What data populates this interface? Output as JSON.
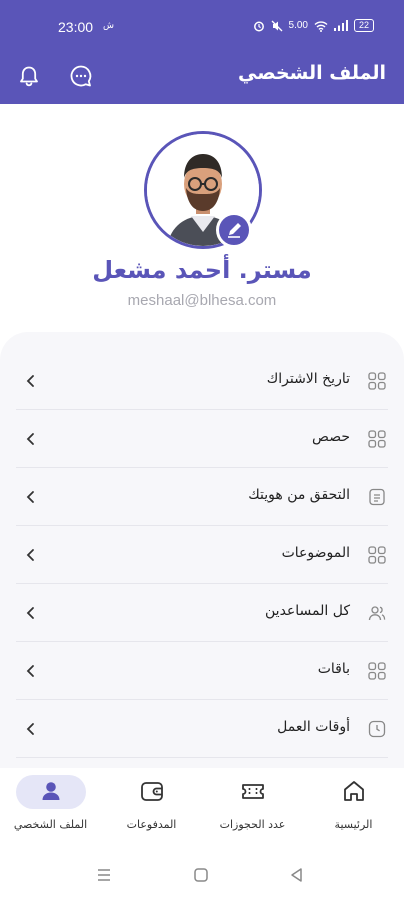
{
  "status_bar": {
    "time": "23:00",
    "left_icon": "ش",
    "speed": "5.00",
    "battery": "22"
  },
  "header": {
    "title": "الملف الشخصي",
    "icons": [
      "bell-icon",
      "chat-icon"
    ]
  },
  "profile": {
    "name": "مستر. أحمد مشعل",
    "email": "meshaal@blhesa.com",
    "edit_icon": "pen-icon"
  },
  "menu": {
    "items": [
      {
        "label": "تاريخ الاشتراك",
        "icon": "grid-icon"
      },
      {
        "label": "حصص",
        "icon": "grid-icon"
      },
      {
        "label": "التحقق من هويتك",
        "icon": "document-icon"
      },
      {
        "label": "الموضوعات",
        "icon": "grid-icon"
      },
      {
        "label": "كل المساعدين",
        "icon": "users-icon"
      },
      {
        "label": "باقات",
        "icon": "grid-icon"
      },
      {
        "label": "أوقات العمل",
        "icon": "clock-icon"
      }
    ]
  },
  "bottom_nav": {
    "items": [
      {
        "label": "الملف الشخصي",
        "icon": "user-icon",
        "active": true
      },
      {
        "label": "المدفوعات",
        "icon": "wallet-icon",
        "active": false
      },
      {
        "label": "عدد الحجوزات",
        "icon": "ticket-icon",
        "active": false
      },
      {
        "label": "الرئيسية",
        "icon": "home-icon",
        "active": false
      }
    ]
  },
  "colors": {
    "primary": "#5a55b8",
    "card_bg": "#f7f7fa",
    "active_pill": "#e5e6f7",
    "email": "#a8a8b0"
  }
}
